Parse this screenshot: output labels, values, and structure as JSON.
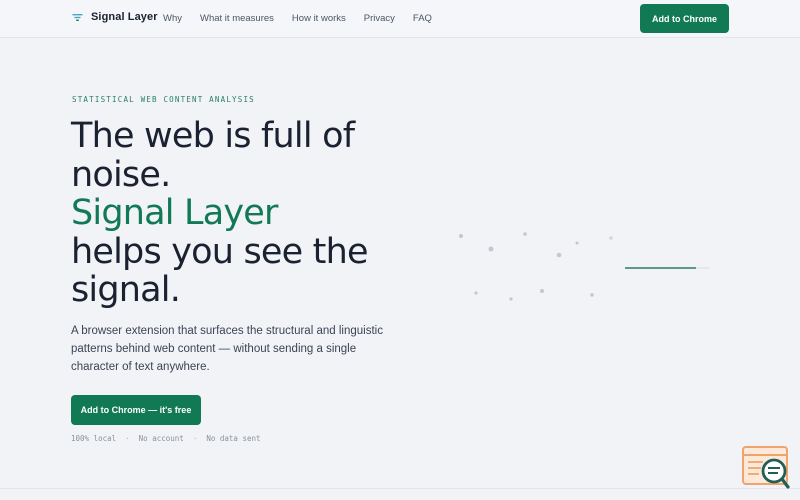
{
  "brand": {
    "name": "Signal Layer",
    "logo_icon": "signal-funnel-icon",
    "accent_color": "#117a55"
  },
  "nav": {
    "items": [
      {
        "label": "Why"
      },
      {
        "label": "What it measures"
      },
      {
        "label": "How it works"
      },
      {
        "label": "Privacy"
      },
      {
        "label": "FAQ"
      }
    ]
  },
  "header": {
    "cta_label": "Add to Chrome"
  },
  "hero": {
    "eyebrow": "STATISTICAL WEB CONTENT ANALYSIS",
    "headline": {
      "line1": "The web is full of",
      "line2": "noise.",
      "line3_accent": "Signal Layer",
      "line4": "helps you see the",
      "line5": "signal."
    },
    "lede": {
      "line1": "A browser extension that surfaces the structural and linguistic",
      "line2": "patterns behind web content — without sending a single",
      "line3": "character of text anywhere."
    },
    "cta_label": "Add to Chrome — it's free",
    "meta": {
      "item1": "100% local",
      "item2": "No account",
      "item3": "No data sent",
      "separator": "·"
    }
  },
  "widget": {
    "icon": "search-chat-icon"
  }
}
